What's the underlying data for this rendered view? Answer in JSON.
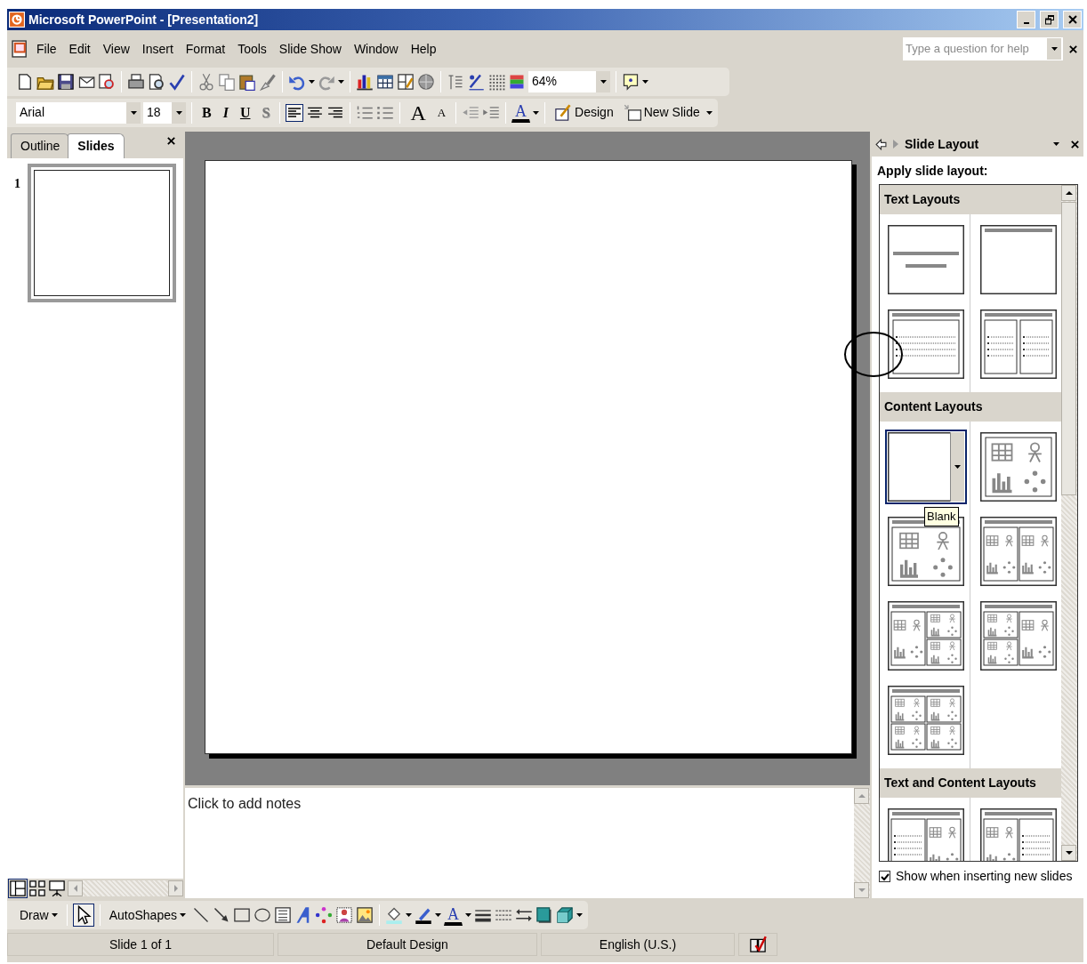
{
  "window": {
    "title": "Microsoft PowerPoint - [Presentation2]"
  },
  "menu": [
    {
      "label": "File"
    },
    {
      "label": "Edit"
    },
    {
      "label": "View"
    },
    {
      "label": "Insert"
    },
    {
      "label": "Format"
    },
    {
      "label": "Tools"
    },
    {
      "label": "Slide Show"
    },
    {
      "label": "Window"
    },
    {
      "label": "Help"
    }
  ],
  "help_box": {
    "placeholder": "Type a question for help"
  },
  "standard_toolbar": {
    "zoom": "64%"
  },
  "formatting_toolbar": {
    "font": "Arial",
    "font_size": "18",
    "style_buttons": [
      "B",
      "I",
      "U",
      "S"
    ],
    "alignment": [
      {
        "selected": true
      },
      {
        "selected": false
      },
      {
        "selected": false
      }
    ],
    "grow_font": "A",
    "shrink_font": "A",
    "font_color": "A",
    "design": {
      "label": "Design"
    },
    "new_slide": {
      "label": "New Slide"
    }
  },
  "panel_tabs": [
    {
      "label": "Outline",
      "selected": false
    },
    {
      "label": "Slides",
      "selected": true
    }
  ],
  "slides": [
    {
      "number": "1",
      "selected": true
    }
  ],
  "notes": {
    "placeholder": "Click to add notes"
  },
  "task_pane": {
    "title": "Slide Layout",
    "heading": "Apply slide layout:",
    "tooltip": "Blank",
    "sections": [
      {
        "title": "Text Layouts",
        "layouts": [
          {
            "kind": "title-slide",
            "selected": false
          },
          {
            "kind": "title-only",
            "selected": false
          },
          {
            "kind": "title-text",
            "selected": false
          },
          {
            "kind": "two-column-text",
            "selected": false
          }
        ]
      },
      {
        "title": "Content Layouts",
        "layouts": [
          {
            "kind": "blank",
            "selected": true
          },
          {
            "kind": "content",
            "selected": false
          },
          {
            "kind": "title-content",
            "selected": false
          },
          {
            "kind": "title-two-content",
            "selected": false
          },
          {
            "kind": "title-content-two-content",
            "selected": false
          },
          {
            "kind": "title-two-content-content",
            "selected": false
          },
          {
            "kind": "title-four-content",
            "selected": false
          }
        ]
      },
      {
        "title": "Text and Content Layouts",
        "layouts": [
          {
            "kind": "title-text-content",
            "selected": false
          },
          {
            "kind": "title-content-text",
            "selected": false
          }
        ]
      }
    ],
    "show_on_insert": {
      "label": "Show when inserting new slides",
      "checked": true
    }
  },
  "draw_toolbar": {
    "draw": {
      "label": "Draw"
    },
    "select_pointer": {
      "selected": true
    },
    "autoshapes": {
      "label": "AutoShapes"
    },
    "font_color": "A"
  },
  "status_bar": [
    {
      "text": "Slide 1 of 1"
    },
    {
      "text": "Default Design"
    },
    {
      "text": "English (U.S.)"
    }
  ]
}
